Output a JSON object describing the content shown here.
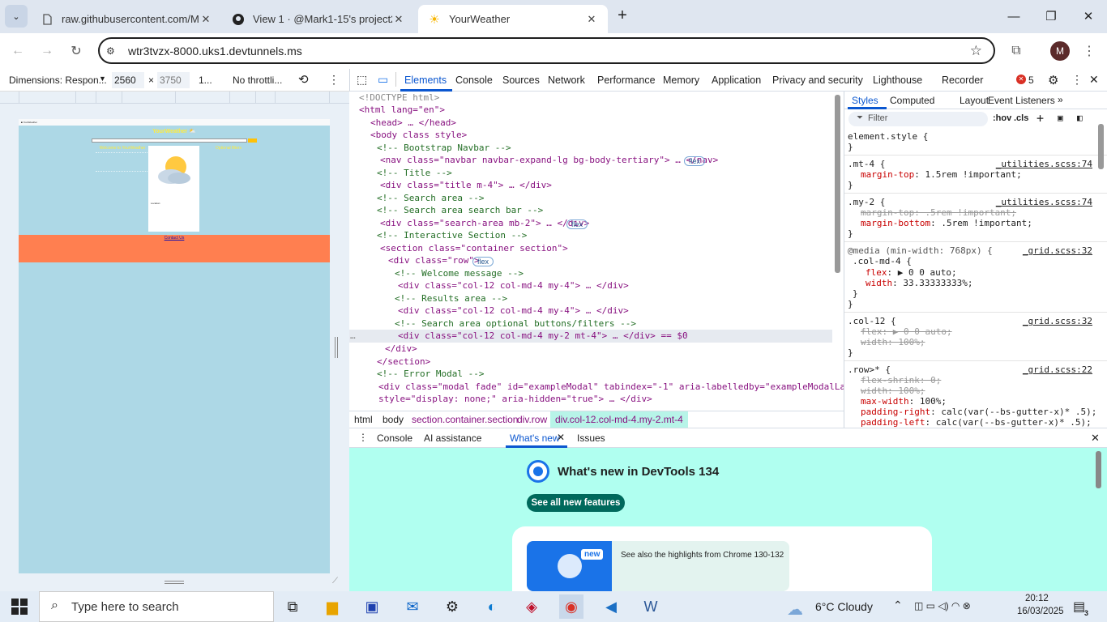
{
  "tabs": [
    {
      "title": "raw.githubusercontent.com/Ma",
      "favicon": "page-icon"
    },
    {
      "title": "View 1 · @Mark1-15's project2",
      "favicon": "github-icon"
    },
    {
      "title": "YourWeather",
      "favicon": "sun-icon"
    }
  ],
  "address": {
    "url": "wtr3tvzx-8000.uks1.devtunnels.ms"
  },
  "profile_initial": "M",
  "device_toolbar": {
    "dimensions": "Dimensions: Respon...",
    "width": "2560",
    "height": "3750",
    "zoom": "1...",
    "throttle": "No throttli..."
  },
  "page_preview": {
    "title": "YourWeather ⛅",
    "welcome": "Welcome to YourWeather",
    "options": "Optional filters",
    "contact": "Contact Us",
    "location": "Location:"
  },
  "devtools": {
    "tabs": [
      "Elements",
      "Console",
      "Sources",
      "Network",
      "Performance",
      "Memory",
      "Application",
      "Privacy and security",
      "Lighthouse",
      "Recorder"
    ],
    "error_count": "5",
    "style_tabs": [
      "Styles",
      "Computed",
      "Layout",
      "Event Listeners"
    ],
    "filter_placeholder": "Filter",
    "hov": ":hov",
    "cls": ".cls",
    "breadcrumbs": [
      "html",
      "body",
      "section.container.section",
      "div.row",
      "div.col-12.col-md-4.my-2.mt-4"
    ],
    "drawer_tabs": [
      "Console",
      "AI assistance",
      "What's new",
      "Issues"
    ],
    "whats_new_title": "What's new in DevTools 134",
    "see_all": "See all new features",
    "highlights": "See also the highlights from Chrome 130-132",
    "new_badge": "new"
  },
  "dom_lines": [
    "<!DOCTYPE html>",
    "<html lang=\"en\">",
    "<head> … </head>",
    "<body class style>",
    "<!-- Bootstrap Navbar -->",
    "<nav class=\"navbar navbar-expand-lg bg-body-tertiary\"> … </nav>",
    "<!-- Title -->",
    "<div class=\"title m-4\"> … </div>",
    "<!-- Search area -->",
    "<!-- Search area search bar -->",
    "<div class=\"search-area mb-2\"> … </div>",
    "<!-- Interactive Section -->",
    "<section class=\"container section\">",
    "<div class=\"row\">",
    "<!-- Welcome message -->",
    "<div class=\"col-12 col-md-4 my-4\"> … </div>",
    "<!-- Results area -->",
    "<div class=\"col-12 col-md-4 my-4\"> … </div>",
    "<!-- Search area optional buttons/filters -->",
    "<div class=\"col-12 col-md-4 my-2 mt-4\"> … </div> == $0",
    "</div>",
    "</section>",
    "<!-- Error Modal -->",
    "<div class=\"modal fade\" id=\"exampleModal\" tabindex=\"-1\" aria-labelledby=\"exampleModalLabel\"",
    "style=\"display: none;\" aria-hidden=\"true\"> … </div>"
  ],
  "css_rules": {
    "element_style": "element.style {",
    "mt4_sel": ".mt-4 {",
    "mt4_src": "_utilities.scss:74",
    "mt4_prop": "margin-top",
    "mt4_val": ": 1.5rem !important;",
    "my2_sel": ".my-2 {",
    "my2_src": "_utilities.scss:74",
    "my2_p1": "margin-top: .5rem !important;",
    "my2_prop2": "margin-bottom",
    "my2_val2": ": .5rem !important;",
    "media": "@media (min-width: 768px) {",
    "media_src": "_grid.scss:32",
    "colmd_sel": ".col-md-4 {",
    "flex_prop": "flex",
    "flex_val": ": ▶ 0 0 auto;",
    "width_prop": "width",
    "width_val": ": 33.33333333%;",
    "col12_sel": ".col-12 {",
    "col12_src": "_grid.scss:32",
    "col12_p1": "flex: ▶ 0 0 auto;",
    "col12_p2": "width: 100%;",
    "row_sel": ".row>* {",
    "row_src": "_grid.scss:22",
    "row_p1": "flex-shrink: 0;",
    "row_p2": "width: 100%;",
    "row_prop3": "max-width",
    "row_val3": ": 100%;",
    "row_prop4": "padding-right",
    "row_val4": ": calc(var(--bs-gutter-x)* .5);",
    "row_prop5": "padding-left",
    "row_val5": ": calc(var(--bs-gutter-x)* .5);"
  },
  "taskbar": {
    "search_placeholder": "Type here to search",
    "weather": "6°C  Cloudy",
    "time": "20:12",
    "date": "16/03/2025",
    "notifications": "3"
  }
}
